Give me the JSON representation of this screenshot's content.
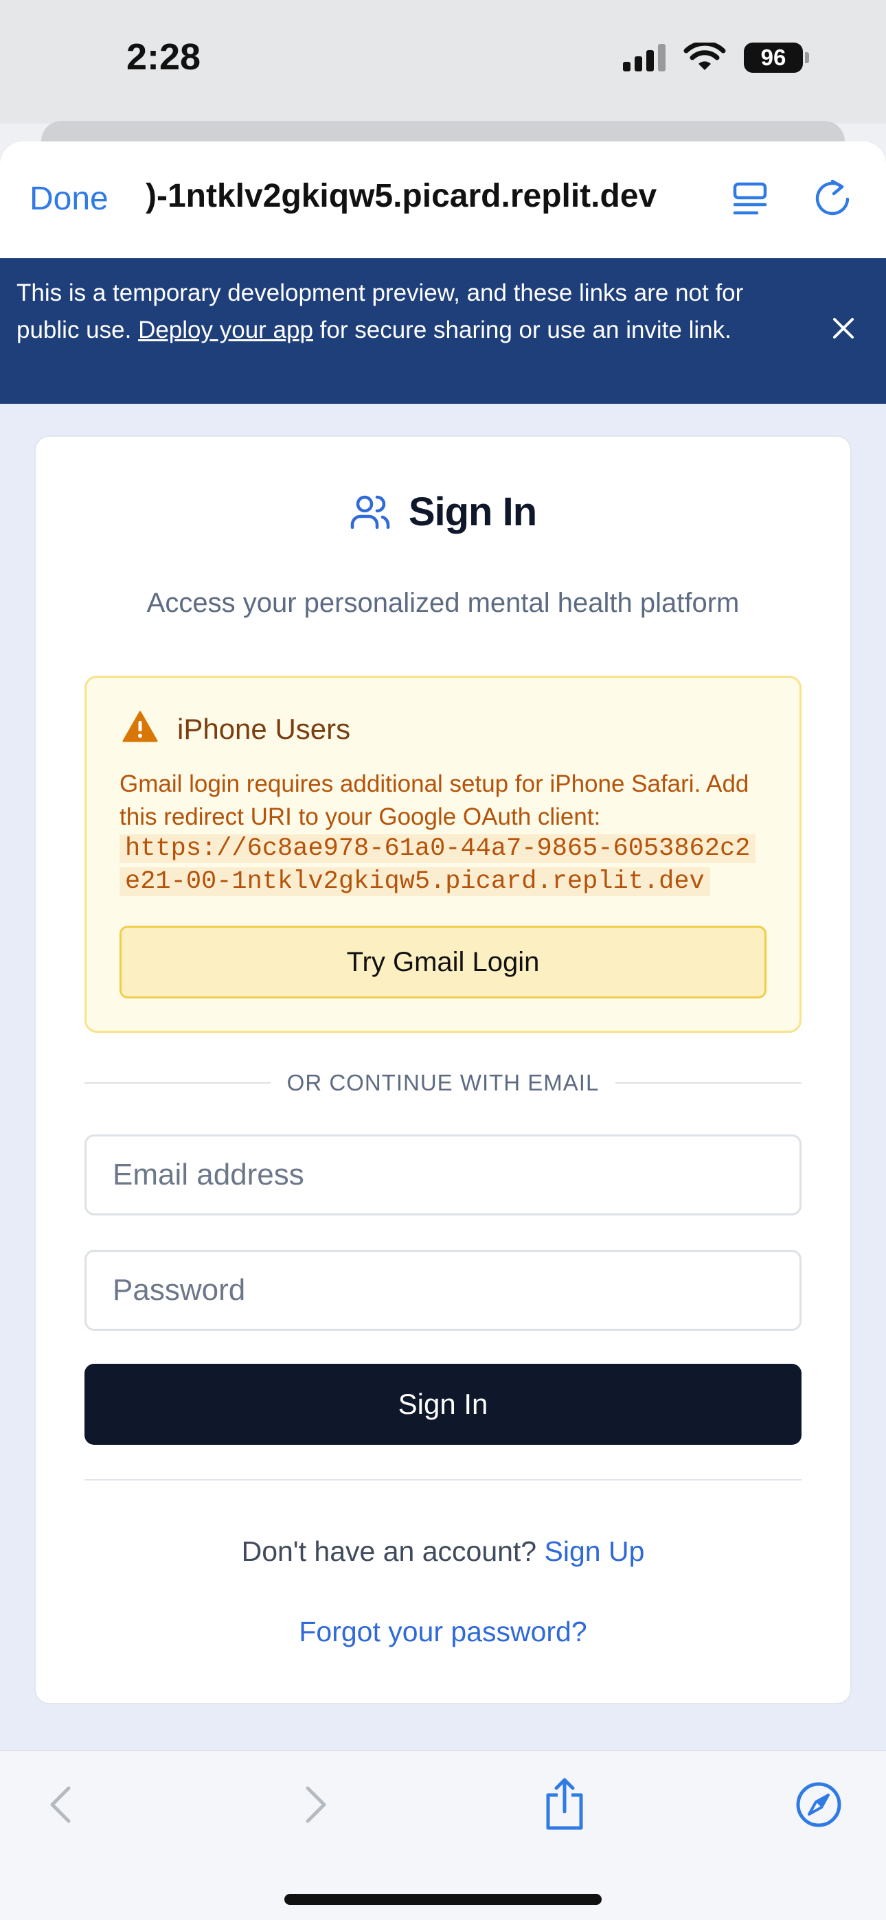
{
  "status_bar": {
    "time": "2:28",
    "battery": "96"
  },
  "browser": {
    "done_label": "Done",
    "url": ")-1ntklv2gkiqw5.picard.replit.dev"
  },
  "banner": {
    "text_before_link": "This is a temporary development preview, and these links are not for public use. ",
    "link_text": "Deploy your app",
    "text_after_link": " for secure sharing or use an invite link."
  },
  "signin": {
    "title": "Sign In",
    "subtitle": "Access your personalized mental health platform",
    "warning": {
      "title": "iPhone Users",
      "text": "Gmail login requires additional setup for iPhone Safari. Add this redirect URI to your Google OAuth client:",
      "redirect_uri": "https://6c8ae978-61a0-44a7-9865-6053862c2e21-00-1ntklv2gkiqw5.picard.replit.dev",
      "button_label": "Try Gmail Login"
    },
    "divider_text": "OR CONTINUE WITH EMAIL",
    "email_placeholder": "Email address",
    "password_placeholder": "Password",
    "submit_label": "Sign In",
    "no_account_text": "Don't have an account? ",
    "signup_link": "Sign Up",
    "forgot_link": "Forgot your password?"
  },
  "colors": {
    "accent": "#2f7ae5",
    "banner_bg": "#1e3f7a",
    "warning_bg": "#fefbe8",
    "warning_text": "#b4530b",
    "primary_button": "#0f172a"
  },
  "icons": {
    "reader": "reader-icon",
    "reload": "reload-icon",
    "close": "close-icon",
    "users": "users-icon",
    "warning": "warning-triangle-icon",
    "back": "chevron-left-icon",
    "forward": "chevron-right-icon",
    "share": "share-icon",
    "compass": "compass-icon"
  }
}
